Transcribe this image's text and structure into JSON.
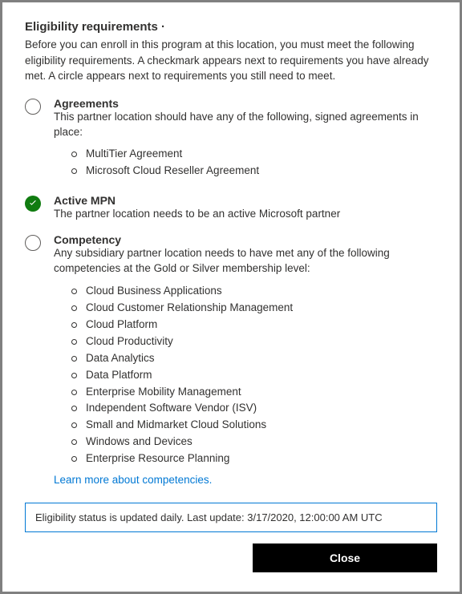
{
  "title": "Eligibility requirements ·",
  "intro": "Before you can enroll in this program at this location, you must meet the following eligibility requirements. A checkmark appears next to requirements you have already met. A circle appears next to requirements you still need to meet.",
  "requirements": [
    {
      "status": "unmet",
      "title": "Agreements",
      "desc": "This partner location should have any of the following, signed agreements in place:",
      "items": [
        "MultiTier Agreement",
        "Microsoft Cloud Reseller Agreement"
      ]
    },
    {
      "status": "met",
      "title": "Active MPN",
      "desc": "The partner location needs to be an active Microsoft partner"
    },
    {
      "status": "unmet",
      "title": "Competency",
      "desc": "Any subsidiary partner location needs to have met any of the following competencies at the Gold or Silver membership level:",
      "items": [
        "Cloud Business Applications",
        "Cloud Customer Relationship Management",
        "Cloud Platform",
        "Cloud Productivity",
        "Data Analytics",
        "Data Platform",
        "Enterprise Mobility Management",
        "Independent Software Vendor (ISV)",
        "Small and Midmarket Cloud Solutions",
        "Windows and Devices",
        "Enterprise Resource Planning"
      ],
      "link": "Learn more about competencies."
    }
  ],
  "status_banner": "Eligibility status is updated daily. Last update: 3/17/2020, 12:00:00 AM UTC",
  "close_label": "Close"
}
